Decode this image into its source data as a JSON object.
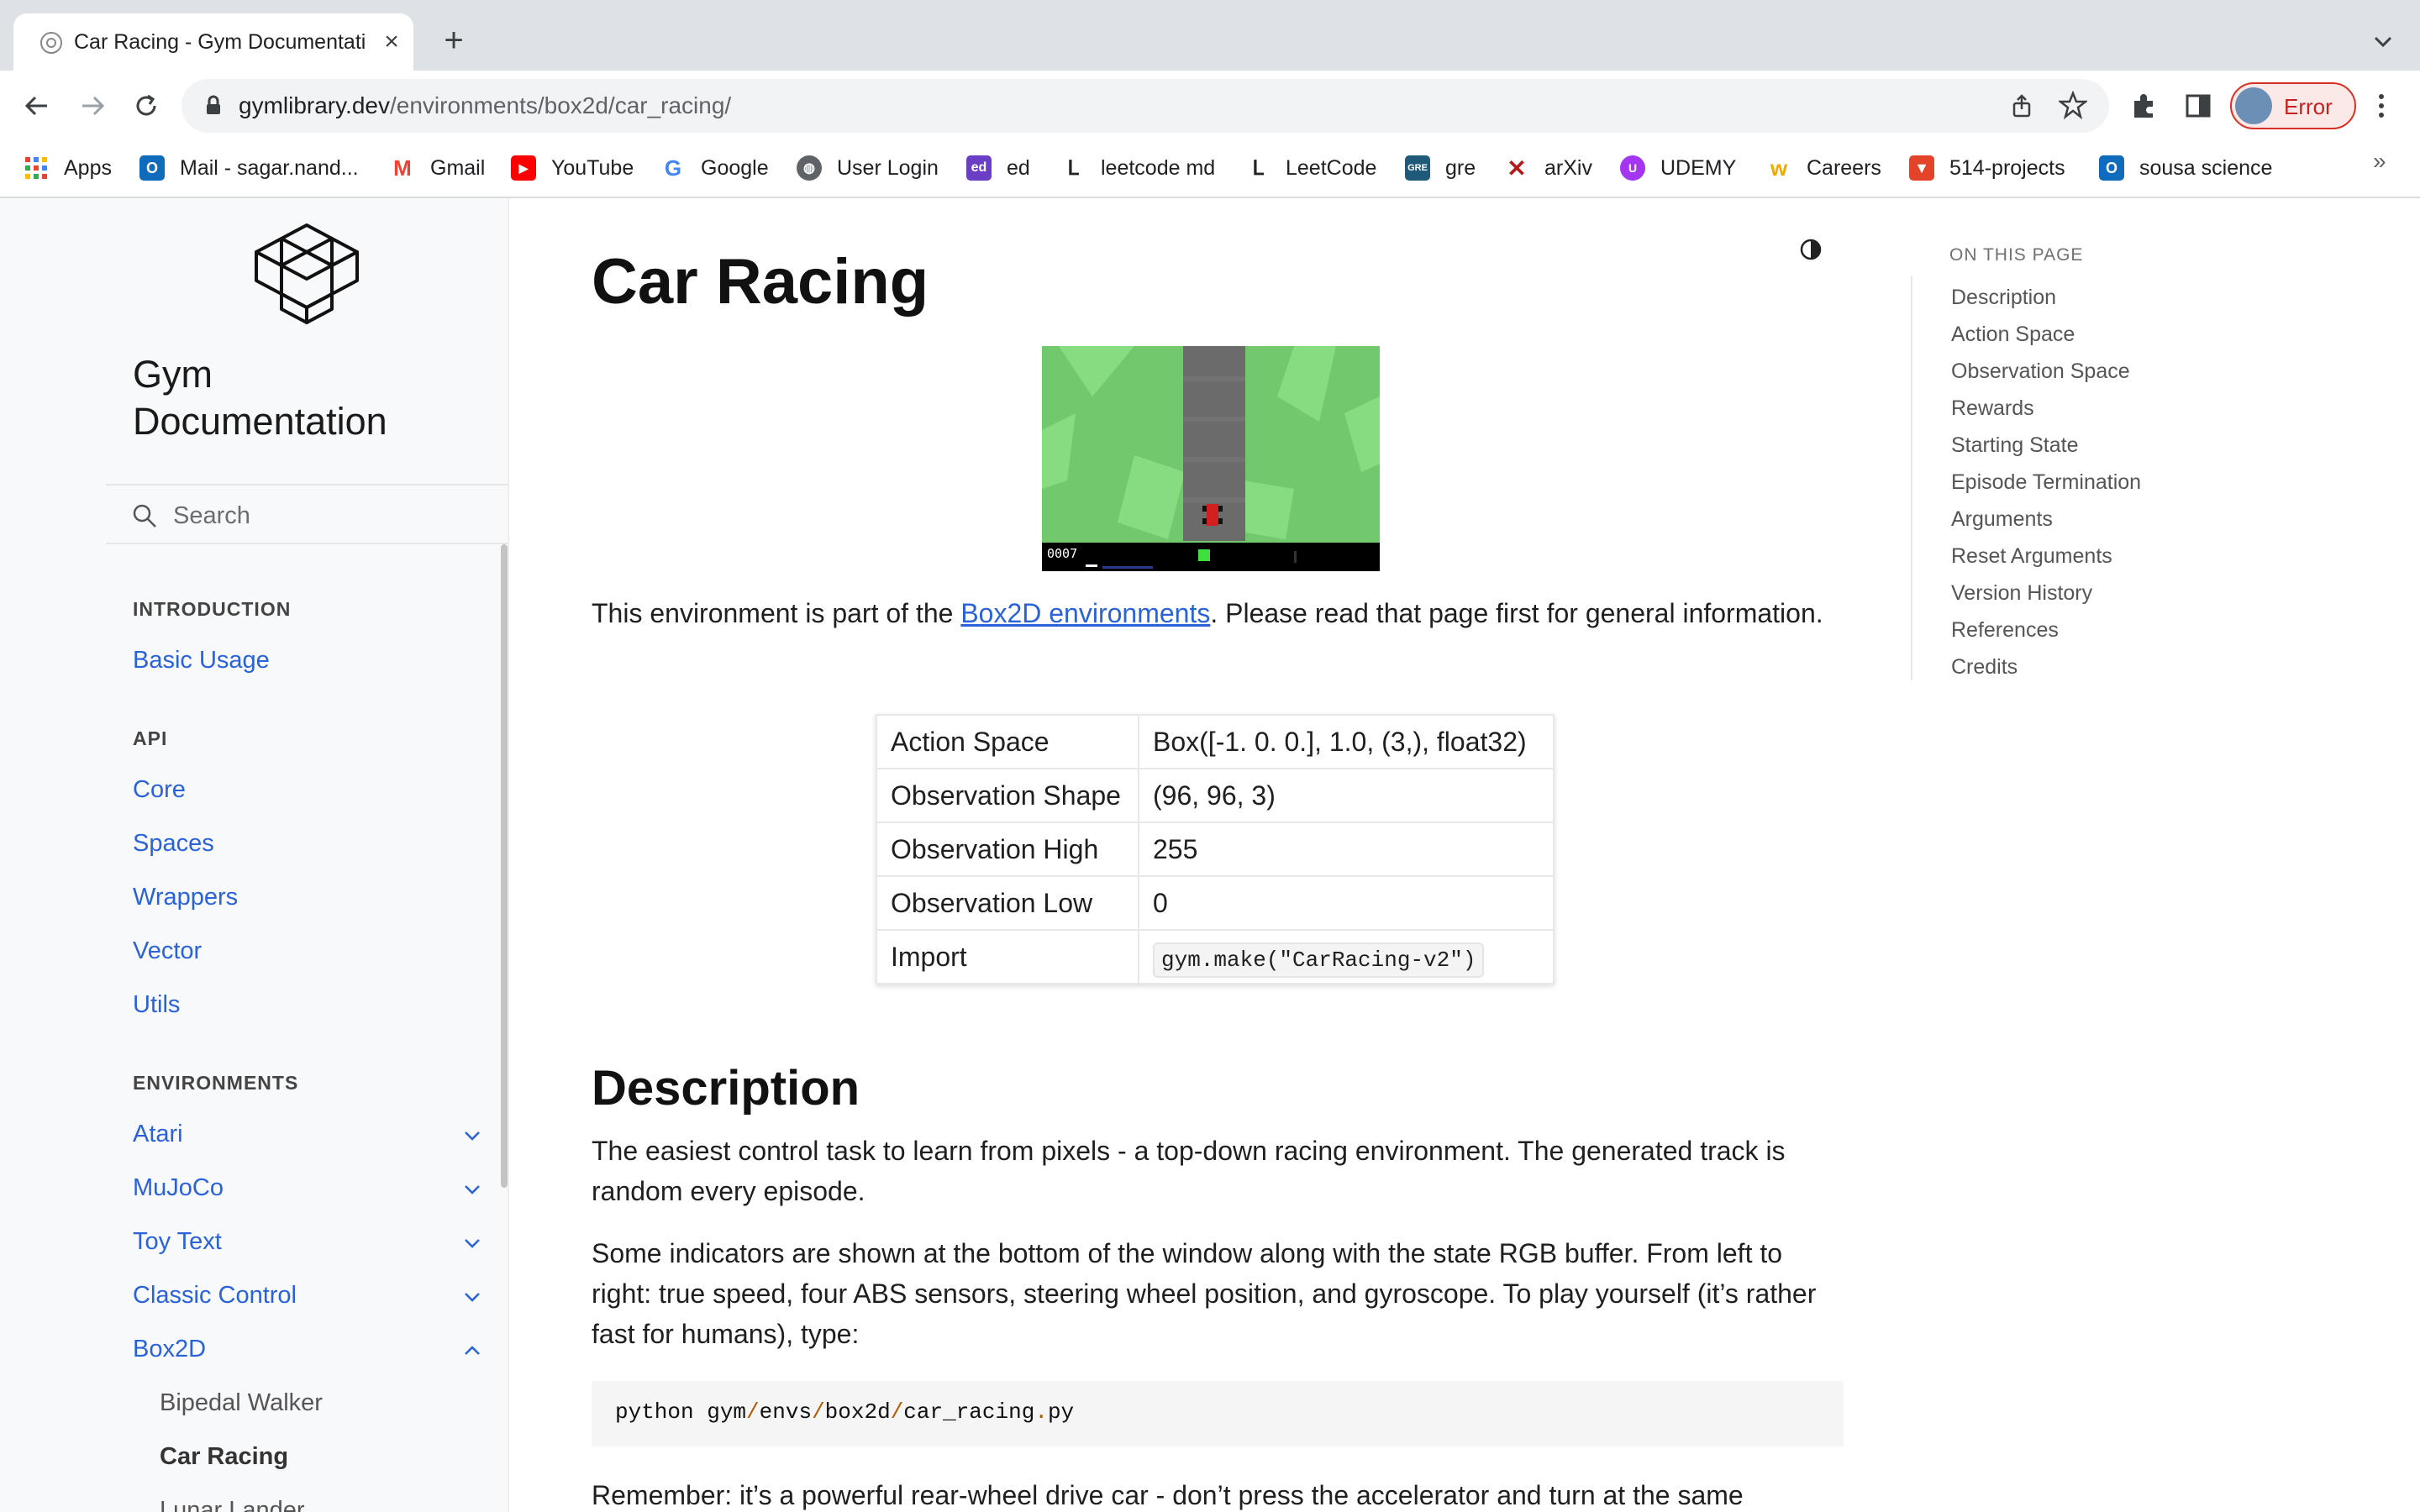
{
  "browser": {
    "tab_title": "Car Racing - Gym Documentati",
    "url_host": "gymlibrary.dev",
    "url_path": "/environments/box2d/car_racing/",
    "profile_status": "Error",
    "bookmarks": [
      {
        "label": "Apps",
        "icon": "apps-grid-icon"
      },
      {
        "label": "Mail - sagar.nand...",
        "icon": "outlook-icon"
      },
      {
        "label": "Gmail",
        "icon": "gmail-icon"
      },
      {
        "label": "YouTube",
        "icon": "youtube-icon"
      },
      {
        "label": "Google",
        "icon": "google-icon"
      },
      {
        "label": "User Login",
        "icon": "globe-icon"
      },
      {
        "label": "ed",
        "icon": "ed-icon"
      },
      {
        "label": "leetcode md",
        "icon": "leetcode-icon"
      },
      {
        "label": "LeetCode",
        "icon": "leetcode-icon"
      },
      {
        "label": "gre",
        "icon": "gre-icon"
      },
      {
        "label": "arXiv",
        "icon": "arxiv-icon"
      },
      {
        "label": "UDEMY",
        "icon": "udemy-icon"
      },
      {
        "label": "Careers",
        "icon": "careers-icon"
      },
      {
        "label": "514-projects",
        "icon": "gitlab-icon"
      },
      {
        "label": "sousa science",
        "icon": "outlook-icon"
      }
    ],
    "bookmarks_more": "»"
  },
  "sidebar": {
    "brand": "Gym Documentation",
    "search_placeholder": "Search",
    "sections": {
      "introduction": "INTRODUCTION",
      "api": "API",
      "environments": "ENVIRONMENTS"
    },
    "intro_items": [
      "Basic Usage"
    ],
    "api_items": [
      "Core",
      "Spaces",
      "Wrappers",
      "Vector",
      "Utils"
    ],
    "env_items": [
      "Atari",
      "MuJoCo",
      "Toy Text",
      "Classic Control",
      "Box2D"
    ],
    "box2d_items": [
      "Bipedal Walker",
      "Car Racing",
      "Lunar Lander"
    ]
  },
  "main": {
    "title": "Car Racing",
    "game_hud_counter": "0007",
    "intro_before_link": "This environment is part of the ",
    "intro_link": "Box2D environments",
    "intro_after_link": ". Please read that page first for general information.",
    "table": [
      {
        "key": "Action Space",
        "value": "Box([-1. 0. 0.], 1.0, (3,), float32)"
      },
      {
        "key": "Observation Shape",
        "value": "(96, 96, 3)"
      },
      {
        "key": "Observation High",
        "value": "255"
      },
      {
        "key": "Observation Low",
        "value": "0"
      },
      {
        "key": "Import",
        "value": "gym.make(\"CarRacing-v2\")"
      }
    ],
    "description_heading": "Description",
    "desc_p1": "The easiest control task to learn from pixels - a top-down racing environment. The generated track is random every episode.",
    "desc_p2": "Some indicators are shown at the bottom of the window along with the state RGB buffer. From left to right: true speed, four ABS sensors, steering wheel position, and gyroscope. To play yourself (it’s rather fast for humans), type:",
    "code_parts": [
      "python gym",
      "/",
      "envs",
      "/",
      "box2d",
      "/",
      "car_racing",
      ".",
      "py"
    ],
    "desc_p3": "Remember: it’s a powerful rear-wheel drive car - don’t press the accelerator and turn at the same"
  },
  "toc": {
    "caption": "ON THIS PAGE",
    "items": [
      "Description",
      "Action Space",
      "Observation Space",
      "Rewards",
      "Starting State",
      "Episode Termination",
      "Arguments",
      "Reset Arguments",
      "Version History",
      "References",
      "Credits"
    ]
  },
  "colors": {
    "link": "#2962d9",
    "sidebar_bg": "#f8f9fb",
    "game_grass": "#72c96d",
    "profile_error": "#c5221f"
  }
}
